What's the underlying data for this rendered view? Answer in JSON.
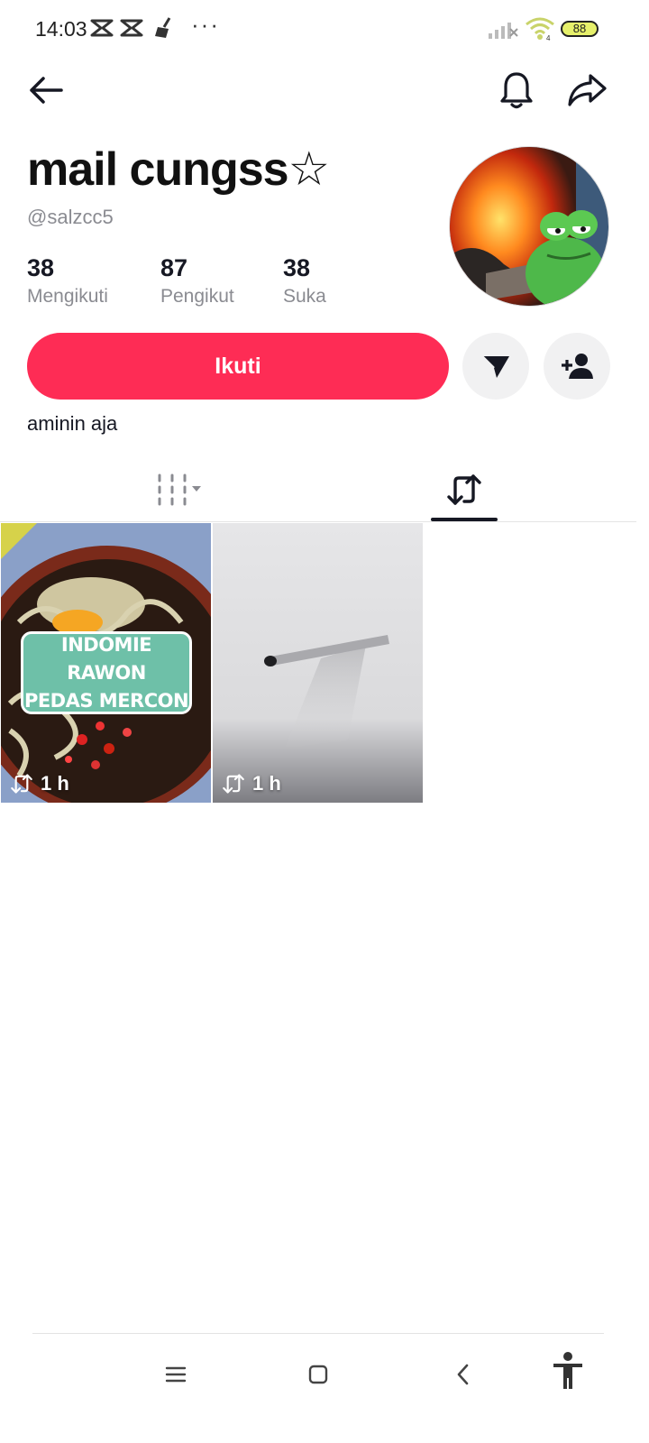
{
  "status_bar": {
    "time": "14:03",
    "icons": [
      "capcut-icon",
      "capcut-icon",
      "broom-icon"
    ],
    "more": "···",
    "battery": "88"
  },
  "header": {
    "back_icon": "arrow-left-icon",
    "bell_icon": "bell-icon",
    "share_icon": "share-icon"
  },
  "profile": {
    "display_name": "mail cungss☆",
    "username": "@salzcc5",
    "bio": "aminin aja",
    "stats": [
      {
        "value": "38",
        "label": "Mengikuti"
      },
      {
        "value": "87",
        "label": "Pengikut"
      },
      {
        "value": "38",
        "label": "Suka"
      }
    ]
  },
  "actions": {
    "follow_label": "Ikuti",
    "message_icon": "send-icon",
    "suggest_icon": "add-user-icon"
  },
  "tabs": [
    {
      "name": "videos",
      "icon": "grid-icon",
      "active": false
    },
    {
      "name": "reposts",
      "icon": "repost-icon",
      "active": true
    }
  ],
  "grid": [
    {
      "caption_line1": "INDOMIE RAWON",
      "caption_line2": "PEDAS MERCON",
      "time": "1 h"
    },
    {
      "time": "1 h"
    }
  ],
  "colors": {
    "accent": "#fe2c55",
    "text_primary": "#161823",
    "text_secondary": "#8a8b91",
    "button_bg": "#f1f1f2"
  }
}
